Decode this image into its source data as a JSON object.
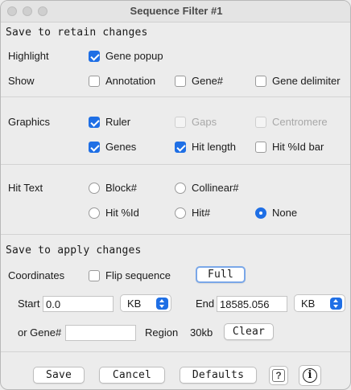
{
  "window": {
    "title": "Sequence Filter #1"
  },
  "retain": {
    "heading": "Save to retain changes",
    "highlight_label": "Highlight",
    "gene_popup": {
      "label": "Gene popup",
      "checked": true
    },
    "show_label": "Show",
    "annotation": {
      "label": "Annotation",
      "checked": false
    },
    "gene_num": {
      "label": "Gene#",
      "checked": false
    },
    "gene_delimiter": {
      "label": "Gene delimiter",
      "checked": false
    }
  },
  "graphics": {
    "label": "Graphics",
    "ruler": {
      "label": "Ruler",
      "checked": true
    },
    "gaps": {
      "label": "Gaps",
      "checked": false,
      "disabled": true
    },
    "centromere": {
      "label": "Centromere",
      "checked": false,
      "disabled": true
    },
    "genes": {
      "label": "Genes",
      "checked": true
    },
    "hit_length": {
      "label": "Hit length",
      "checked": true
    },
    "hit_pctid_bar": {
      "label": "Hit %Id bar",
      "checked": false
    }
  },
  "hit_text": {
    "label": "Hit Text",
    "options": [
      "Block#",
      "Collinear#",
      "Hit %Id",
      "Hit#",
      "None"
    ],
    "selected": "None"
  },
  "apply": {
    "heading": "Save to apply changes",
    "coordinates_label": "Coordinates",
    "flip_sequence": {
      "label": "Flip sequence",
      "checked": false
    },
    "full_button": "Full",
    "start_label": "Start",
    "start_value": "0.0",
    "start_unit": "KB",
    "end_label": "End",
    "end_value": "18585.056",
    "end_unit": "KB",
    "gene_label": "or Gene#",
    "gene_value": "",
    "region_label": "Region",
    "region_value": "30kb",
    "clear_button": "Clear"
  },
  "footer": {
    "save": "Save",
    "cancel": "Cancel",
    "defaults": "Defaults",
    "help_icon": "question-mark-icon",
    "info_icon": "info-icon"
  },
  "colors": {
    "accent": "#1f6fe5",
    "background": "#ececec"
  }
}
